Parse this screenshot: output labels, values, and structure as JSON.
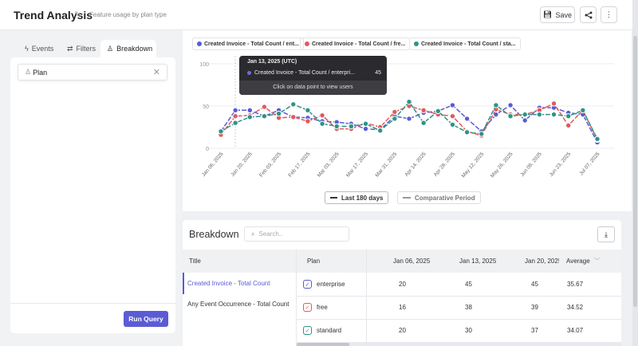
{
  "header": {
    "title": "Trend Analysis",
    "subtitle": "Feature usage by plan type",
    "save_label": "Save"
  },
  "left_panel": {
    "tabs": [
      {
        "label": "Events",
        "icon": "bolt-icon"
      },
      {
        "label": "Filters",
        "icon": "sliders-icon"
      },
      {
        "label": "Breakdown",
        "icon": "person-icon",
        "active": true
      }
    ],
    "breakdown_property": "Plan",
    "run_query_label": "Run Query"
  },
  "chart": {
    "series_chips": [
      "Created Invoice - Total Count / ent...",
      "Created Invoice - Total Count / fre...",
      "Created Invoice - Total Count / sta..."
    ],
    "tooltip": {
      "date": "Jan 13, 2025 (UTC)",
      "series": "Created Invoice - Total Count / enterpri...",
      "value": "45",
      "hint": "Click on data point to view users"
    },
    "legend": {
      "current": "Last 180 days",
      "comparative": "Comparative Period"
    }
  },
  "chart_data": {
    "type": "line",
    "x": [
      "Jan 06, 2025",
      "Jan 13, 2025",
      "Jan 20, 2025",
      "Jan 27, 2025",
      "Feb 03, 2025",
      "Feb 10, 2025",
      "Feb 17, 2025",
      "Feb 24, 2025",
      "Mar 03, 2025",
      "Mar 10, 2025",
      "Mar 17, 2025",
      "Mar 24, 2025",
      "Mar 31, 2025",
      "Apr 07, 2025",
      "Apr 14, 2025",
      "Apr 21, 2025",
      "Apr 28, 2025",
      "May 05, 2025",
      "May 12, 2025",
      "May 19, 2025",
      "May 26, 2025",
      "Jun 02, 2025",
      "Jun 09, 2025",
      "Jun 16, 2025",
      "Jun 23, 2025",
      "Jun 30, 2025",
      "Jul 07, 2025"
    ],
    "x_tick_labels": [
      "Jan 06, 2025",
      "Jan 20, 2025",
      "Feb 03, 2025",
      "Feb 17, 2025",
      "Mar 03, 2025",
      "Mar 17, 2025",
      "Mar 31, 2025",
      "Apr 14, 2025",
      "Apr 28, 2025",
      "May 12, 2025",
      "May 26, 2025",
      "Jun 09, 2025",
      "Jun 23, 2025",
      "Jul 07, 2025"
    ],
    "y_ticks": [
      "0",
      "50",
      "100"
    ],
    "ylim": [
      0,
      100
    ],
    "grid": true,
    "series": [
      {
        "name": "Created Invoice - Total Count / enterprise",
        "color": "#5b5bd6",
        "values": [
          20,
          45,
          45,
          38,
          45,
          37,
          36,
          32,
          31,
          29,
          23,
          22,
          38,
          35,
          42,
          44,
          51,
          35,
          20,
          40,
          51,
          33,
          48,
          48,
          42,
          40,
          7
        ]
      },
      {
        "name": "Created Invoice - Total Count / free",
        "color": "#e05a5f",
        "values": [
          16,
          38,
          39,
          49,
          36,
          37,
          32,
          39,
          23,
          23,
          30,
          25,
          43,
          50,
          45,
          40,
          38,
          20,
          15,
          46,
          40,
          40,
          45,
          53,
          27,
          45,
          10
        ]
      },
      {
        "name": "Created Invoice - Total Count / standard",
        "color": "#2e9485",
        "values": [
          20,
          30,
          37,
          38,
          41,
          52,
          45,
          29,
          26,
          26,
          29,
          21,
          35,
          55,
          30,
          44,
          28,
          19,
          17,
          51,
          38,
          40,
          40,
          40,
          38,
          45,
          11
        ]
      }
    ]
  },
  "breakdown": {
    "title": "Breakdown",
    "search_placeholder": "Search..",
    "columns": {
      "title": "Title",
      "plan": "Plan",
      "dates": [
        "Jan 06, 2025",
        "Jan 13, 2025",
        "Jan 20, 2025"
      ],
      "average": "Average"
    },
    "events": [
      "Created Invoice - Total Count",
      "Any Event Occurrence - Total Count"
    ],
    "rows": [
      {
        "plan": "enterprise",
        "color": "#5b5bd6",
        "values": [
          "20",
          "45",
          "45"
        ],
        "average": "35.67"
      },
      {
        "plan": "free",
        "color": "#e05a5f",
        "values": [
          "16",
          "38",
          "39"
        ],
        "average": "34.52"
      },
      {
        "plan": "standard",
        "color": "#2e9485",
        "values": [
          "20",
          "30",
          "37"
        ],
        "average": "34.07"
      }
    ]
  }
}
